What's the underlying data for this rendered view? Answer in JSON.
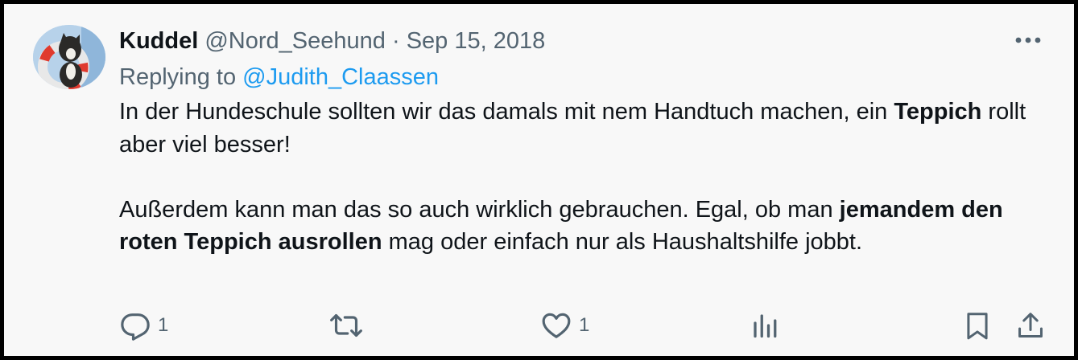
{
  "tweet": {
    "display_name": "Kuddel",
    "handle": "@Nord_Seehund",
    "separator": "·",
    "date": "Sep 15, 2018",
    "replying_prefix": "Replying to",
    "replying_handle": "@Judith_Claassen",
    "body": {
      "p1_a": "In der Hundeschule sollten wir das damals mit nem Handtuch machen, ein",
      "p1_b": "Teppich",
      "p1_c": " rollt aber viel besser!",
      "p2_a": "Außerdem kann man das so auch wirklich gebrauchen. Egal, ob man",
      "p2_b": "jemandem den roten Teppich ausrollen",
      "p2_c": " mag oder einfach nur als Haushaltshilfe jobbt."
    }
  },
  "actions": {
    "reply_count": "1",
    "like_count": "1"
  },
  "icons": {
    "more": "more-icon",
    "reply": "reply-icon",
    "retweet": "retweet-icon",
    "like": "like-icon",
    "views": "views-icon",
    "bookmark": "bookmark-icon",
    "share": "share-icon"
  },
  "colors": {
    "text": "#0f1419",
    "secondary": "#536471",
    "link": "#1d9bf0",
    "background": "#f8f8f8",
    "border": "#000000"
  }
}
